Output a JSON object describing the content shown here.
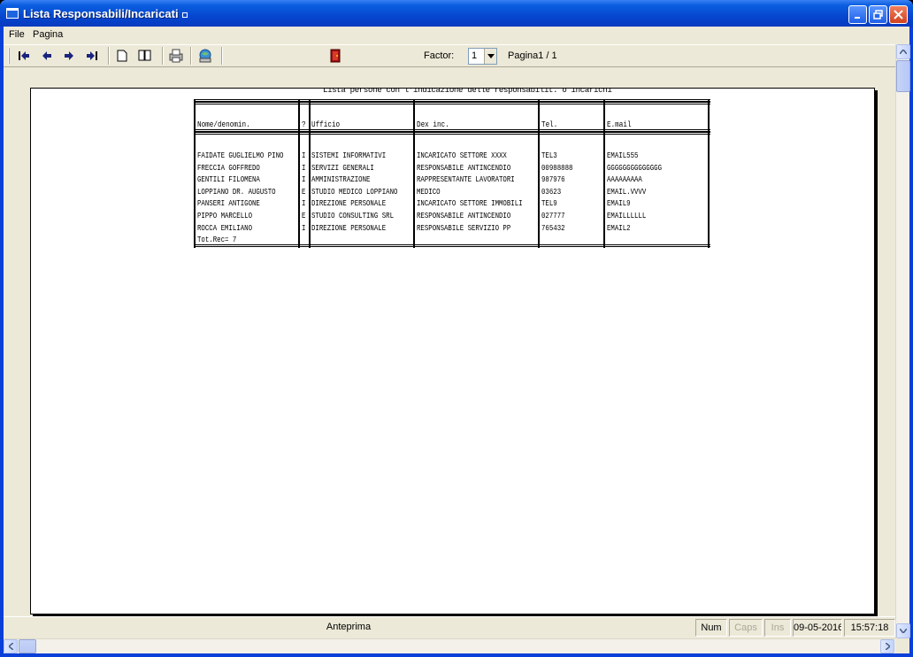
{
  "window": {
    "title": "Lista Responsabili/Incaricati"
  },
  "menu": {
    "file": "File",
    "pagina": "Pagina"
  },
  "toolbar": {
    "buttons": [
      "first-page-icon",
      "prev-page-icon",
      "next-page-icon",
      "last-page-icon",
      "single-page-icon",
      "two-page-icon",
      "print-icon",
      "export-icon",
      "exit-icon"
    ],
    "factor_label": "Factor:",
    "factor_value": "1",
    "page_label": "Pagina1 / 1"
  },
  "report": {
    "heading": "Lista persone con l'indicazione delle responsabilit. o incarichi",
    "headers": {
      "name": "Nome/denomin.",
      "type": "?",
      "office": "Ufficio",
      "desc": "Dex inc.",
      "tel": "Tel.",
      "email": "E.mail"
    },
    "rows": [
      {
        "name": "FAIDATE GUGLIELMO PINO",
        "type": "I",
        "office": "SISTEMI INFORMATIVI",
        "desc": "INCARICATO SETTORE XXXX",
        "tel": "TEL3",
        "email": "EMAIL555"
      },
      {
        "name": "FRECCIA GOFFREDO",
        "type": "I",
        "office": "SERVIZI GENERALI",
        "desc": "RESPONSABILE ANTINCENDIO",
        "tel": "00988888",
        "email": "GGGGGGGGGGGGGG"
      },
      {
        "name": "GENTILI FILOMENA",
        "type": "I",
        "office": "AMMINISTRAZIONE",
        "desc": "RAPPRESENTANTE LAVORATORI",
        "tel": "987976",
        "email": "AAAAAAAAA"
      },
      {
        "name": "LOPPIANO DR. AUGUSTO",
        "type": "E",
        "office": "STUDIO MEDICO LOPPIANO",
        "desc": "MEDICO",
        "tel": "03623",
        "email": "EMAIL.VVVV"
      },
      {
        "name": "PANSERI ANTIGONE",
        "type": "I",
        "office": "DIREZIONE PERSONALE",
        "desc": "INCARICATO SETTORE IMMOBILI",
        "tel": "TEL9",
        "email": "EMAIL9"
      },
      {
        "name": "PIPPO MARCELLO",
        "type": "E",
        "office": "STUDIO CONSULTING SRL",
        "desc": "RESPONSABILE ANTINCENDIO",
        "tel": "027777",
        "email": "EMAILLLLLL"
      },
      {
        "name": "ROCCA EMILIANO",
        "type": "I",
        "office": "DIREZIONE PERSONALE",
        "desc": "RESPONSABILE SERVIZIO PP",
        "tel": "765432",
        "email": "EMAIL2"
      }
    ],
    "total": "Tot.Rec= 7"
  },
  "status": {
    "main": "Anteprima",
    "num": "Num",
    "caps": "Caps",
    "ins": "Ins",
    "date": "09-05-2016",
    "time": "15:57:18"
  }
}
